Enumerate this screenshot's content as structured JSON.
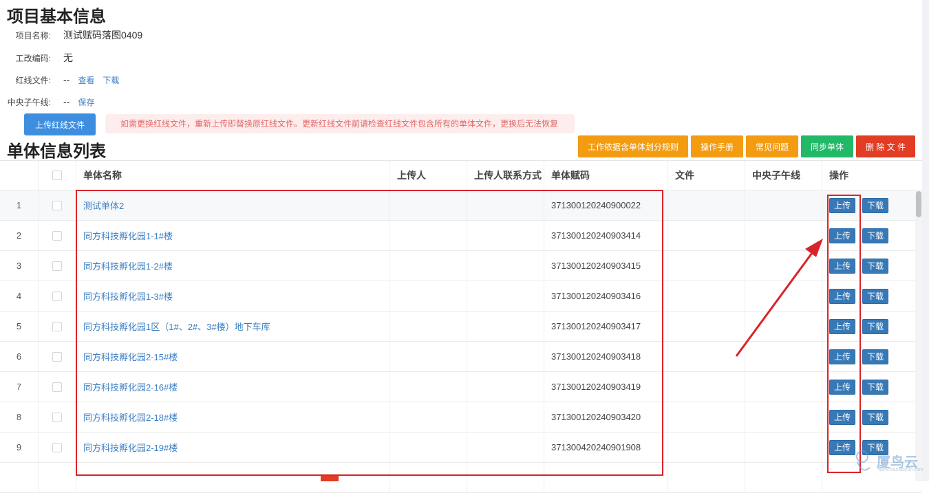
{
  "project": {
    "title": "项目基本信息",
    "rows": [
      {
        "label": "项目名称:",
        "value": "测试赋码落图0409"
      },
      {
        "label": "工改编码:",
        "value": "无"
      },
      {
        "label": "红线文件:",
        "value": "--",
        "links": [
          "查看",
          "下载"
        ]
      },
      {
        "label": "中央子午线:",
        "value": "--",
        "links": [
          "保存"
        ]
      }
    ],
    "upload_button": "上传红线文件",
    "warning": "如需更换红线文件，重新上传即替换原红线文件。更新红线文件前请检查红线文件包含所有的单体文件，更换后无法恢复"
  },
  "list": {
    "title": "单体信息列表",
    "toolbar": [
      "工作依据含单体划分规则",
      "操作手册",
      "常见问题",
      "同步单体",
      "删 除 文 件"
    ],
    "headers": [
      "",
      "",
      "单体名称",
      "上传人",
      "上传人联系方式",
      "单体赋码",
      "文件",
      "中央子午线",
      "操作"
    ],
    "op_labels": {
      "upload": "上传",
      "download": "下载"
    },
    "rows": [
      {
        "index": "1",
        "name": "测试单体2",
        "code": "371300120240900022"
      },
      {
        "index": "2",
        "name": "同方科技孵化园1-1#楼",
        "code": "371300120240903414"
      },
      {
        "index": "3",
        "name": "同方科技孵化园1-2#楼",
        "code": "371300120240903415"
      },
      {
        "index": "4",
        "name": "同方科技孵化园1-3#楼",
        "code": "371300120240903416"
      },
      {
        "index": "5",
        "name": "同方科技孵化园1区（1#、2#、3#楼）地下车库",
        "code": "371300120240903417"
      },
      {
        "index": "6",
        "name": "同方科技孵化园2-15#楼",
        "code": "371300120240903418"
      },
      {
        "index": "7",
        "name": "同方科技孵化园2-16#楼",
        "code": "371300120240903419"
      },
      {
        "index": "8",
        "name": "同方科技孵化园2-18#楼",
        "code": "371300120240903420"
      },
      {
        "index": "9",
        "name": "同方科技孵化园2-19#楼",
        "code": "371300420240901908"
      }
    ]
  },
  "watermark": {
    "text": "厦鸟云",
    "sub": "www.xianiaoyun.com"
  },
  "colors": {
    "accent": "#3c7fc4",
    "orange": "#f39c12",
    "green": "#21b968",
    "red": "#e23c24",
    "annotation": "#d9232b"
  }
}
